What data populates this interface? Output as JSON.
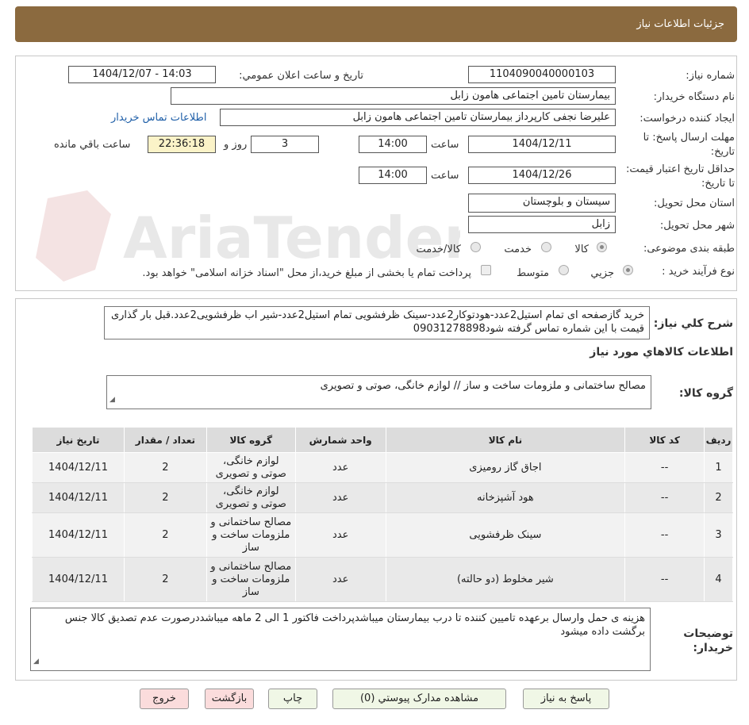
{
  "header": {
    "title": "جزئیات اطلاعات نیاز"
  },
  "form": {
    "need_no_label": "شماره نياز:",
    "need_no": "1104090040000103",
    "announce_label": "تاريخ و ساعت اعلان عمومي:",
    "announce_value": "1404/12/07 - 14:03",
    "buyer_org_label": "نام دستگاه خريدار:",
    "buyer_org": "بیمارستان تامین اجتماعی هامون  زابل",
    "creator_label": "ايجاد کننده درخواست:",
    "creator": "علیرضا نجفی کارپرداز بیمارستان تامین اجتماعی هامون  زابل",
    "contact_link": "اطلاعات تماس خريدار",
    "deadline_label": "مهلت ارسال پاسخ: تا تاريخ:",
    "deadline_date": "1404/12/11",
    "time_label": "ساعت",
    "deadline_time": "14:00",
    "days_value": "3",
    "days_label": "روز و",
    "remaining_time": "22:36:18",
    "remaining_label": "ساعت باقي مانده",
    "validity_label": "حداقل تاريخ اعتبار قيمت: تا تاريخ:",
    "validity_date": "1404/12/26",
    "validity_time": "14:00",
    "province_label": "استان محل تحويل:",
    "province": "سیستان و بلوچستان",
    "city_label": "شهر محل تحويل:",
    "city": "زابل",
    "category_label": "طبقه بندی موضوعی:",
    "category_options": [
      "کالا",
      "خدمت",
      "کالا/خدمت"
    ],
    "process_label": "نوع فرآیند خرید :",
    "process_options": [
      "جزیي",
      "متوسط"
    ],
    "process_note": "پرداخت تمام یا بخشی از مبلغ خرید،از محل \"اسناد خزانه اسلامی\" خواهد بود."
  },
  "watermark": {
    "text": "AriaTender.neT"
  },
  "summary": {
    "desc_label": "شرح کلي نياز:",
    "desc": "خرید گازصفحه ای تمام استیل2عدد-هودتوکار2عدد-سینک ظرفشویی تمام استیل2عدد-شیر اب ظرفشویی2عدد.قبل بار گذاری قیمت با این شماره تماس گرفته شود09031278898",
    "goods_info_title": "اطلاعات کالاهاي مورد نياز",
    "goods_group_label": "گروه کالا:",
    "goods_group": "مصالح ساختمانی و ملزومات ساخت و ساز // لوازم خانگی، صوتی و تصویری"
  },
  "table": {
    "headers": [
      "رديف",
      "کد کالا",
      "نام کالا",
      "واحد شمارش",
      "گروه کالا",
      "تعداد / مقدار",
      "تاريخ نياز"
    ],
    "rows": [
      [
        "1",
        "--",
        "اجاق گاز رومیزی",
        "عدد",
        "لوازم خانگی، صوتی و تصویری",
        "2",
        "1404/12/11"
      ],
      [
        "2",
        "--",
        "هود آشپزخانه",
        "عدد",
        "لوازم خانگی، صوتی و تصویری",
        "2",
        "1404/12/11"
      ],
      [
        "3",
        "--",
        "سینک ظرفشویی",
        "عدد",
        "مصالح ساختمانی و ملزومات ساخت و ساز",
        "2",
        "1404/12/11"
      ],
      [
        "4",
        "--",
        "شیر مخلوط (دو حالته)",
        "عدد",
        "مصالح ساختمانی و ملزومات ساخت و ساز",
        "2",
        "1404/12/11"
      ]
    ]
  },
  "buyer_notes": {
    "label": "توضيحات خريدار:",
    "text": "هزینه ی حمل وارسال برعهده تامیین کننده تا درب بیمارستان میباشدپرداخت فاکتور 1 الی 2 ماهه میباشددرصورت عدم تصدیق کالا جنس برگشت داده میشود"
  },
  "buttons": {
    "reply": "پاسخ به نياز",
    "attachments": "مشاهده مدارک پيوستي (0)",
    "print": "چاپ",
    "back": "بازگشت",
    "exit": "خروج"
  }
}
